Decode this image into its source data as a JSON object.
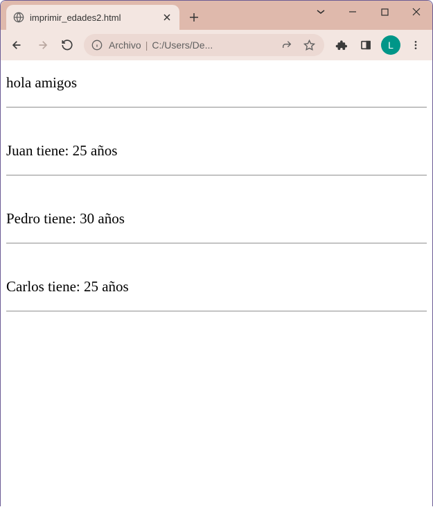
{
  "window": {
    "tab_title": "imprimir_edades2.html",
    "profile_initial": "L"
  },
  "address": {
    "prefix": "Archivo",
    "separator": "|",
    "url_display": "C:/Users/De..."
  },
  "page": {
    "greeting": "hola amigos",
    "entries": [
      {
        "text": "Juan tiene: 25 años"
      },
      {
        "text": "Pedro tiene: 30 años"
      },
      {
        "text": "Carlos tiene: 25 años"
      }
    ]
  }
}
